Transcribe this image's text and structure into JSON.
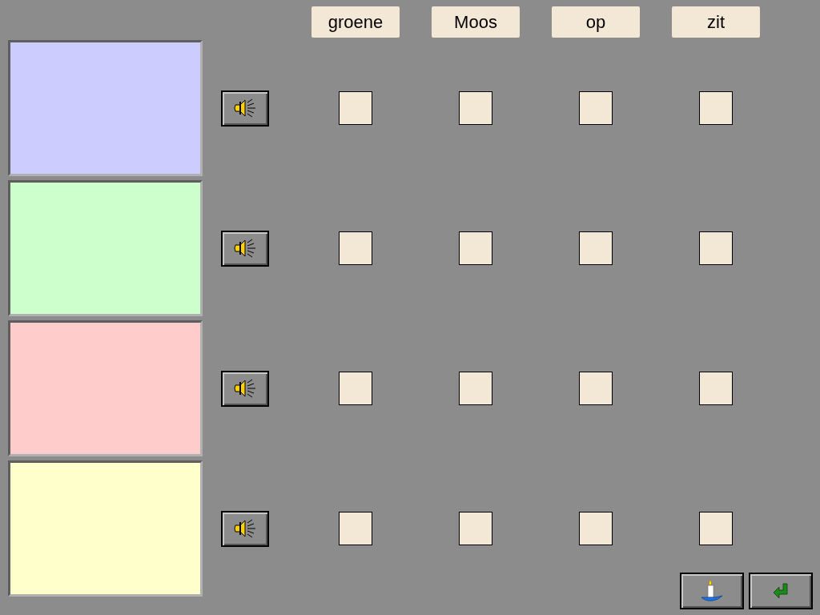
{
  "words": [
    "groene",
    "Moos",
    "op",
    "zit"
  ],
  "rows": [
    {
      "color": "#ccccff",
      "boxes": [
        {
          "checked": false
        },
        {
          "checked": false
        },
        {
          "checked": false
        },
        {
          "checked": false
        }
      ]
    },
    {
      "color": "#ccffcc",
      "boxes": [
        {
          "checked": false
        },
        {
          "checked": false
        },
        {
          "checked": false
        },
        {
          "checked": false
        }
      ]
    },
    {
      "color": "#ffcccc",
      "boxes": [
        {
          "checked": false
        },
        {
          "checked": false
        },
        {
          "checked": false
        },
        {
          "checked": false
        }
      ]
    },
    {
      "color": "#ffffcc",
      "boxes": [
        {
          "checked": false
        },
        {
          "checked": false
        },
        {
          "checked": false
        },
        {
          "checked": false
        }
      ]
    }
  ]
}
